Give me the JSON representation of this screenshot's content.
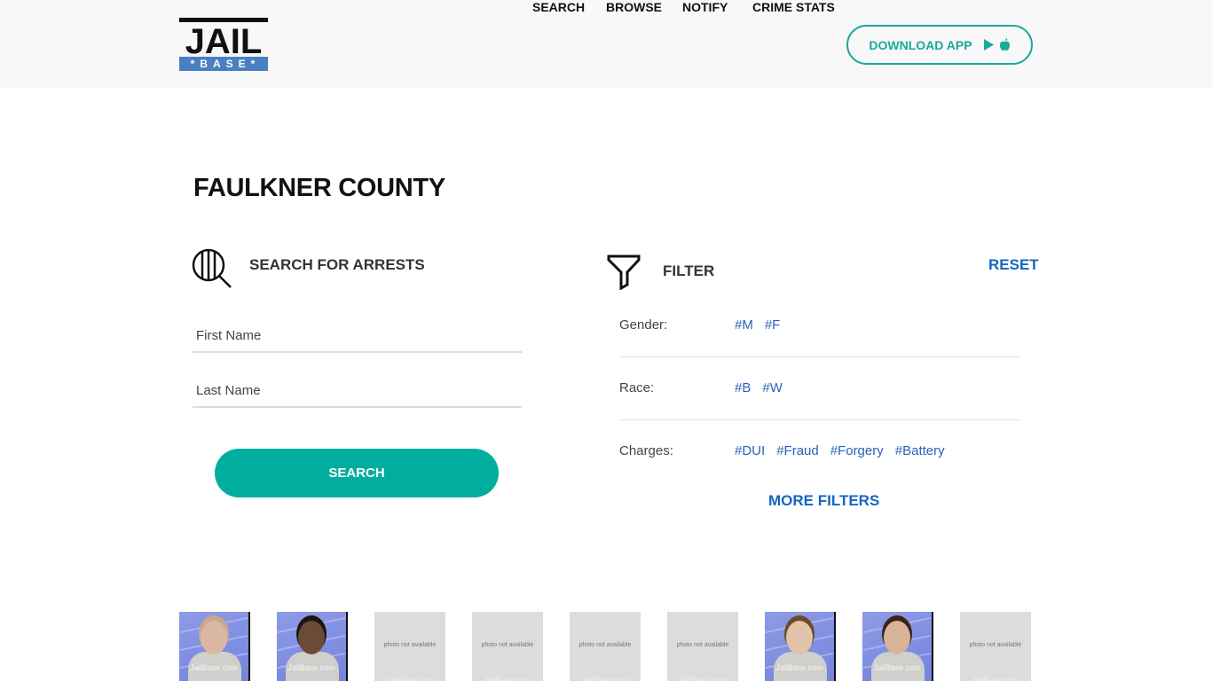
{
  "header": {
    "logo": {
      "top": "JAIL",
      "bottom": "*BASE*"
    },
    "nav": [
      {
        "label": "SEARCH"
      },
      {
        "label": "BROWSE"
      },
      {
        "label": "NOTIFY"
      },
      {
        "label": "CRIME STATS"
      }
    ],
    "download_app": {
      "label": "DOWNLOAD APP",
      "icons": [
        "play-store-icon",
        "apple-icon"
      ]
    }
  },
  "page": {
    "title": "FAULKNER COUNTY"
  },
  "search": {
    "heading": "SEARCH FOR ARRESTS",
    "icon": "search-icon",
    "first_name": {
      "placeholder": "First Name",
      "value": ""
    },
    "last_name": {
      "placeholder": "Last Name",
      "value": ""
    },
    "button_label": "SEARCH"
  },
  "filter": {
    "heading": "FILTER",
    "icon": "filter-icon",
    "reset_label": "RESET",
    "rows": [
      {
        "label": "Gender:",
        "tags": [
          "#M",
          "#F"
        ]
      },
      {
        "label": "Race:",
        "tags": [
          "#B",
          "#W"
        ]
      },
      {
        "label": "Charges:",
        "tags": [
          "#DUI",
          "#Fraud",
          "#Forgery",
          "#Battery"
        ]
      }
    ],
    "more_label": "MORE FILTERS"
  },
  "mugshots": {
    "na_text": "photo not available",
    "watermark": "JailBase.com",
    "items": [
      {
        "type": "photo"
      },
      {
        "type": "photo"
      },
      {
        "type": "na"
      },
      {
        "type": "na"
      },
      {
        "type": "na"
      },
      {
        "type": "na"
      },
      {
        "type": "photo"
      },
      {
        "type": "photo"
      },
      {
        "type": "na"
      }
    ]
  },
  "colors": {
    "teal": "#00ad9f",
    "link_blue": "#1565c0",
    "tag_blue": "#2a62b8",
    "logo_blue": "#4a7fc1"
  }
}
